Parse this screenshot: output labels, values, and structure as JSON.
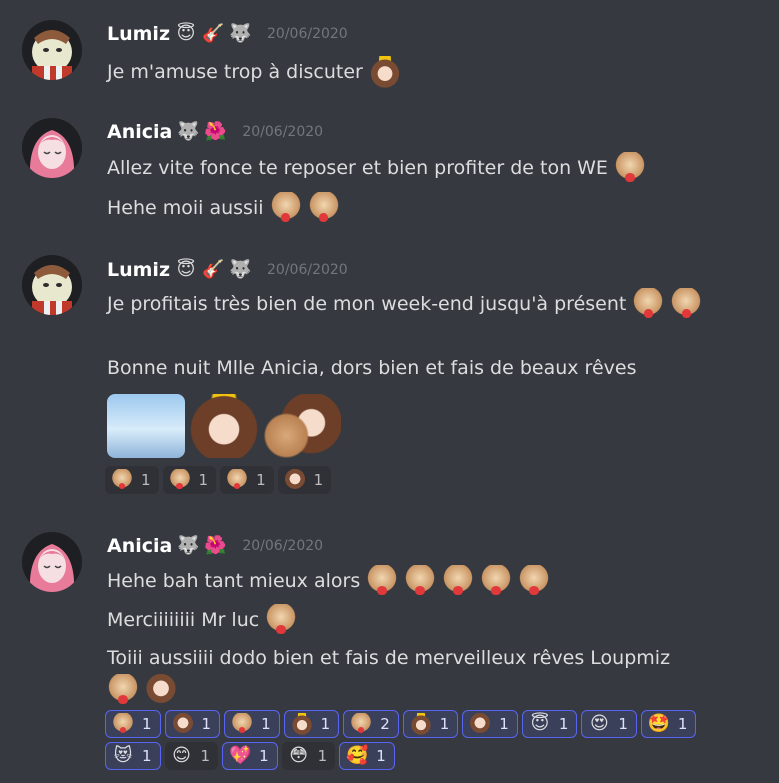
{
  "messages": [
    {
      "username": "Lumiz",
      "badges": [
        "😇",
        "🎸",
        "🐺"
      ],
      "timestamp": "20/06/2020",
      "lines": [
        "Je m'amuse trop à discuter"
      ]
    },
    {
      "username": "Anicia",
      "badges": [
        "🐺",
        "🌺"
      ],
      "timestamp": "20/06/2020",
      "lines": [
        "Allez vite fonce te reposer et bien profiter de ton WE",
        "Hehe moii aussii"
      ]
    },
    {
      "username": "Lumiz",
      "badges": [
        "😇",
        "🎸",
        "🐺"
      ],
      "timestamp": "20/06/2020",
      "lines": [
        "Je profitais très bien de mon week-end jusqu'à présent",
        "Bonne nuit Mlle Anicia, dors bien et fais de beaux rêves"
      ],
      "reactions": [
        {
          "emoji": "cat-heart",
          "count": "1",
          "me": false
        },
        {
          "emoji": "cat-heart",
          "count": "1",
          "me": false
        },
        {
          "emoji": "cat-wink",
          "count": "1",
          "me": false
        },
        {
          "emoji": "cat-pink",
          "count": "1",
          "me": false
        }
      ]
    },
    {
      "username": "Anicia",
      "badges": [
        "🐺",
        "🌺"
      ],
      "timestamp": "20/06/2020",
      "lines": [
        "Hehe bah tant mieux alors",
        "Merciiiiiiii Mr luc",
        "Toiii aussiiii dodo bien et fais de merveilleux rêves Loupmiz"
      ],
      "reactions": [
        {
          "emoji": "cat-heart",
          "count": "1",
          "me": true
        },
        {
          "emoji": "cat-girl",
          "count": "1",
          "me": true
        },
        {
          "emoji": "cat-wink",
          "count": "1",
          "me": true
        },
        {
          "emoji": "angel-girl",
          "count": "1",
          "me": true
        },
        {
          "emoji": "cat-heart",
          "count": "2",
          "me": true
        },
        {
          "emoji": "angel-girl",
          "count": "1",
          "me": true
        },
        {
          "emoji": "girl",
          "count": "1",
          "me": true
        },
        {
          "emoji": "😇",
          "count": "1",
          "me": true
        },
        {
          "emoji": "😍",
          "count": "1",
          "me": true
        },
        {
          "emoji": "🤩",
          "count": "1",
          "me": true
        },
        {
          "emoji": "😻",
          "count": "1",
          "me": true
        },
        {
          "emoji": "😊",
          "count": "1",
          "me": false
        },
        {
          "emoji": "💖",
          "count": "1",
          "me": true
        },
        {
          "emoji": "😳",
          "count": "1",
          "me": false
        },
        {
          "emoji": "🥰",
          "count": "1",
          "me": true
        }
      ]
    }
  ],
  "colors": {
    "background": "#36393f",
    "username": "#ffffff",
    "timestamp": "#72767d",
    "text": "#dcddde",
    "reaction_bg": "#2f3136",
    "reaction_me_bg": "#3b405a",
    "reaction_me_border": "#5865f2"
  }
}
